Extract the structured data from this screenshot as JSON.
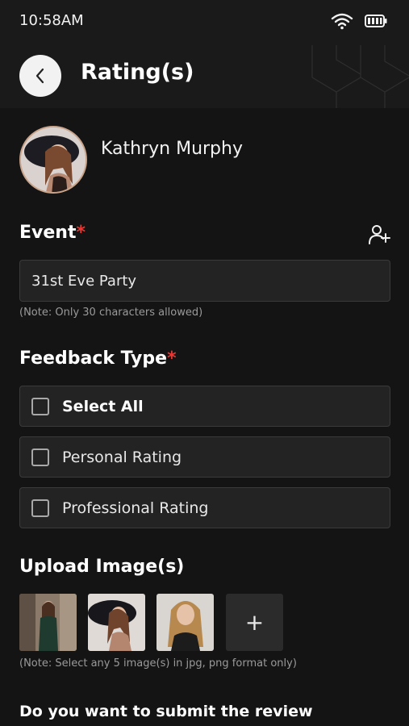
{
  "status_bar": {
    "time": "10:58AM"
  },
  "header": {
    "title": "Rating(s)"
  },
  "profile": {
    "name": "Kathryn Murphy"
  },
  "event": {
    "label": "Event",
    "required_mark": "*",
    "value": "31st Eve Party",
    "note": "(Note: Only 30 characters allowed)"
  },
  "feedback": {
    "label": "Feedback Type",
    "required_mark": "*",
    "options": [
      {
        "label": "Select All",
        "checked": false
      },
      {
        "label": "Personal Rating",
        "checked": false
      },
      {
        "label": "Professional Rating",
        "checked": false
      }
    ]
  },
  "upload": {
    "label": "Upload Image(s)",
    "add_glyph": "+",
    "note": "(Note: Select any 5 image(s) in jpg, png format only)"
  },
  "question": {
    "text": "Do you want to submit the review anonymously?"
  },
  "colors": {
    "accent_required": "#e53935",
    "background": "#141414",
    "field": "#232323"
  }
}
